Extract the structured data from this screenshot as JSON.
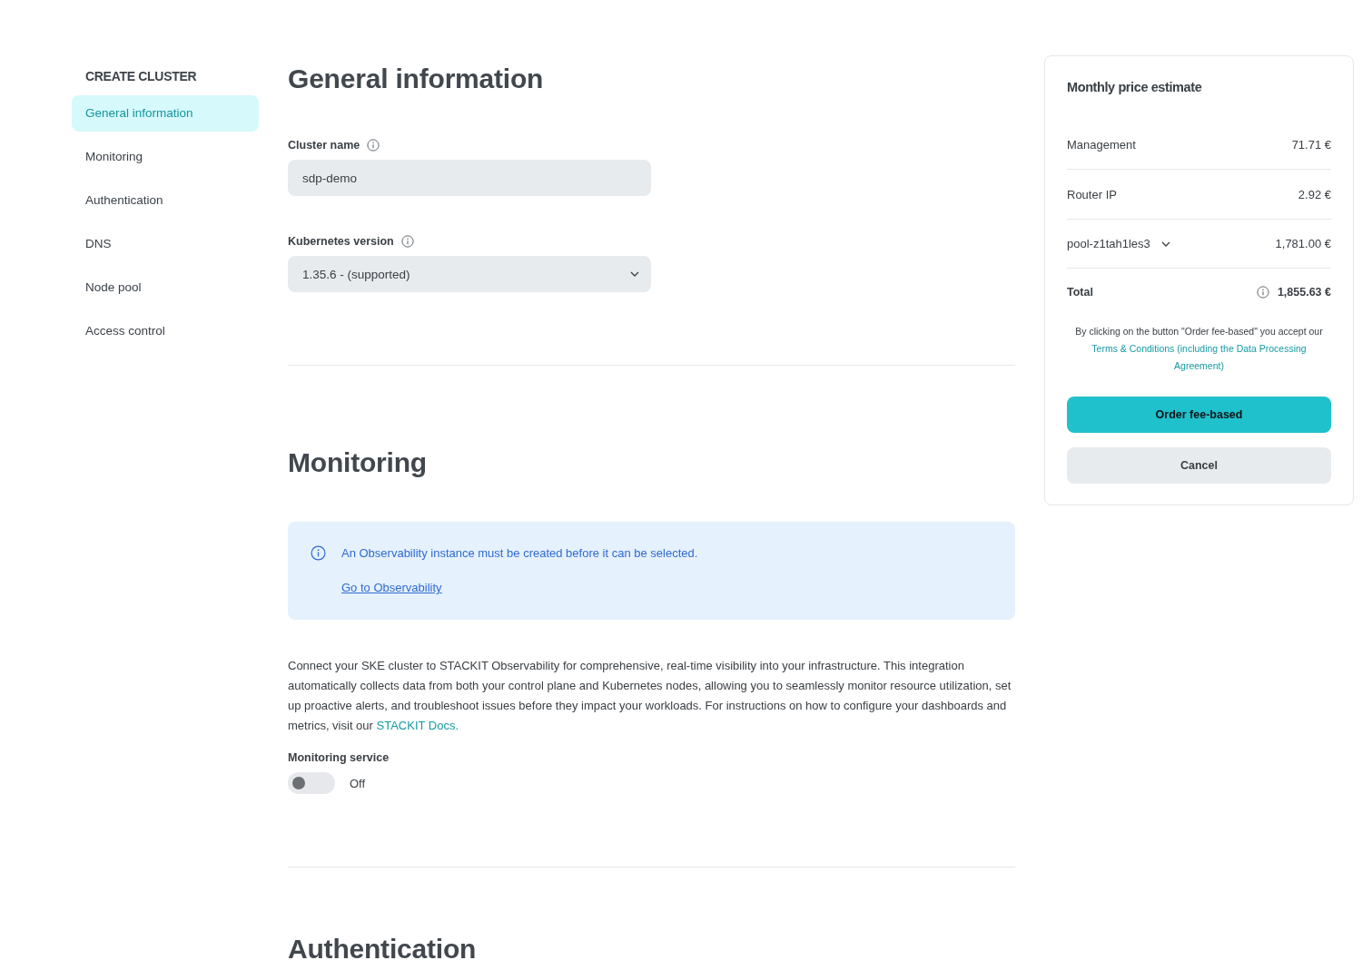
{
  "sidebar": {
    "title": "CREATE CLUSTER",
    "items": [
      {
        "label": "General information",
        "selected": true
      },
      {
        "label": "Monitoring",
        "selected": false
      },
      {
        "label": "Authentication",
        "selected": false
      },
      {
        "label": "DNS",
        "selected": false
      },
      {
        "label": "Node pool",
        "selected": false
      },
      {
        "label": "Access control",
        "selected": false
      }
    ]
  },
  "sections": [
    {
      "kind": "fields",
      "title": "General information",
      "fields": [
        {
          "kind": "text",
          "label": "Cluster name",
          "value": "sdp-demo"
        },
        {
          "kind": "select",
          "label": "Kubernetes version",
          "value": "1.35.6 - (supported)"
        }
      ]
    },
    {
      "kind": "monitoring",
      "title": "Monitoring",
      "notice": {
        "message": "An Observability instance must be created before it can be selected.",
        "link": "Go to Observability"
      },
      "description": "Connect your SKE cluster to STACKIT Observability for comprehensive, real-time visibility into your infrastructure. This integration automatically collects data from both your control plane and Kubernetes nodes, allowing you to seamlessly monitor resource utilization, set up proactive alerts, and troubleshoot issues before they impact your workloads. For instructions on how to configure your dashboards and metrics, visit our",
      "description_link": "STACKIT Docs.",
      "toggle": {
        "label": "Monitoring service",
        "on": false,
        "state_text": "Off"
      }
    },
    {
      "kind": "fields",
      "title": "Authentication"
    }
  ],
  "price_estimate": {
    "title": "Monthly price estimate",
    "items": [
      {
        "kind": "plain",
        "label": "Management",
        "price": "71.71 €"
      },
      {
        "kind": "plain",
        "label": "Router IP",
        "price": "2.92 €"
      },
      {
        "kind": "group",
        "label": "pool-z1tah1les3",
        "price": "1,781.00 €"
      }
    ],
    "total": {
      "label": "Total",
      "price": "1,855.63 €"
    },
    "terms": {
      "text": "By clicking on the button \"Order fee-based\" you accept our",
      "link": "Terms & Conditions (including the Data Processing Agreement)"
    },
    "buttons": [
      {
        "kind": "primary",
        "label": "Order fee-based"
      },
      {
        "kind": "secondary",
        "label": "Cancel"
      }
    ]
  }
}
